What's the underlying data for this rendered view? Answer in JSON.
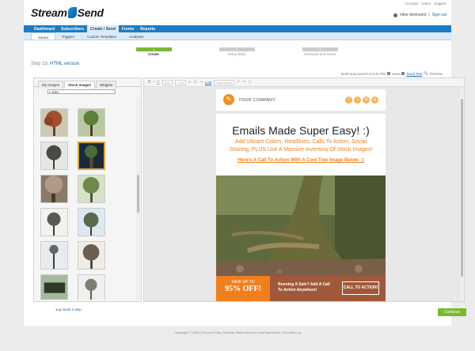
{
  "brand": {
    "logo_a": "Stream",
    "logo_b": "Send"
  },
  "toplinks": [
    "Account",
    "Users",
    "Support"
  ],
  "user": {
    "name": "mike devincent",
    "sep": "|",
    "signout": "Sign out"
  },
  "nav": [
    {
      "label": "Dashboard",
      "active": false
    },
    {
      "label": "Subscribers",
      "active": false
    },
    {
      "label": "Create / Send",
      "active": true
    },
    {
      "label": "Forms",
      "active": false
    },
    {
      "label": "Reports",
      "active": false
    }
  ],
  "subnav": [
    {
      "label": "Saved",
      "active": true
    },
    {
      "label": "Triggers",
      "active": false
    },
    {
      "label": "Custom Templates",
      "active": false
    },
    {
      "label": "Analyses",
      "active": false
    }
  ],
  "steps": [
    {
      "num": "1",
      "label": "Create",
      "active": true
    },
    {
      "num": "2",
      "label": "Setup Blast",
      "active": false
    },
    {
      "num": "3",
      "label": "Schedule and Send!",
      "active": false
    }
  ],
  "step_title": {
    "prefix": "Step 1b:",
    "link": "HTML version"
  },
  "saved": {
    "text": "Draft auto-saved at 8:41 PM",
    "save": "Save",
    "send_test": "Send Test",
    "preview": "Preview"
  },
  "sidebar": {
    "tabs": [
      {
        "label": "My Images",
        "active": false
      },
      {
        "label": "Stock Images",
        "active": true
      },
      {
        "label": "Widgets",
        "active": false
      }
    ],
    "search_value": "tree"
  },
  "toolbar": {
    "b": "B",
    "i": "I",
    "u": "U",
    "size": "Size",
    "font": "Font",
    "link": "Link",
    "image_manager": "Mail Merge"
  },
  "email": {
    "company": "YOUR COMPANY",
    "social": [
      "f",
      "t",
      "in",
      "g"
    ],
    "headline": "Emails Made Super Easy! :)",
    "sub": "Add Vibrant Colors, Headlines, Calls To Action, Social Sharing, PLUS Use A Massive Inventory Of Stock Images!",
    "cta": "Here's A Call To Action With A Cool Tree Image Below. :)",
    "banner_left_1": "SAVE UP TO",
    "banner_left_2": "95% OFF!",
    "banner_mid": "Running A Sale? Add A Call To Action Anywhere!",
    "banner_btn": "CALL TO ACTION!"
  },
  "goback": "go back a step",
  "continue": "Continue",
  "footer": "Copyright © 2018 | Privacy Policy, Security Statement and Legal Agreement | Security Log",
  "colors": {
    "nav_blue": "#1d7bc2",
    "green": "#7cb832",
    "orange": "#f07f1e",
    "brown": "#a0583a"
  }
}
